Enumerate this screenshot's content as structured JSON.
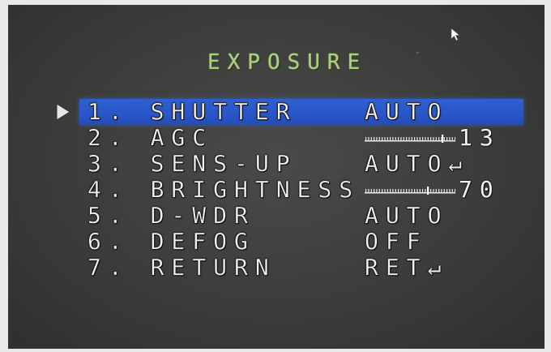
{
  "menu": {
    "title": "EXPOSURE",
    "selected_index": 0,
    "items": [
      {
        "label": "1. SHUTTER",
        "value": "AUTO"
      },
      {
        "label": "2. AGC",
        "value": "13",
        "slider_level": 13,
        "slider_max": 15
      },
      {
        "label": "3. SENS-UP",
        "value": "AUTO↵"
      },
      {
        "label": "4. BRIGHTNESS",
        "value": "70",
        "slider_level": 70,
        "slider_max": 100
      },
      {
        "label": "5. D-WDR",
        "value": "AUTO"
      },
      {
        "label": "6. DEFOG",
        "value": "OFF"
      },
      {
        "label": "7. RETURN",
        "value": "RET↵"
      }
    ]
  },
  "colors": {
    "highlight": "#2956c8",
    "title": "#a9d07a",
    "text": "#f2f2f2",
    "background": "#3c3c3a"
  },
  "icons": {
    "pointer": "selection-arrow-icon",
    "cursor": "mouse-cursor-icon"
  }
}
